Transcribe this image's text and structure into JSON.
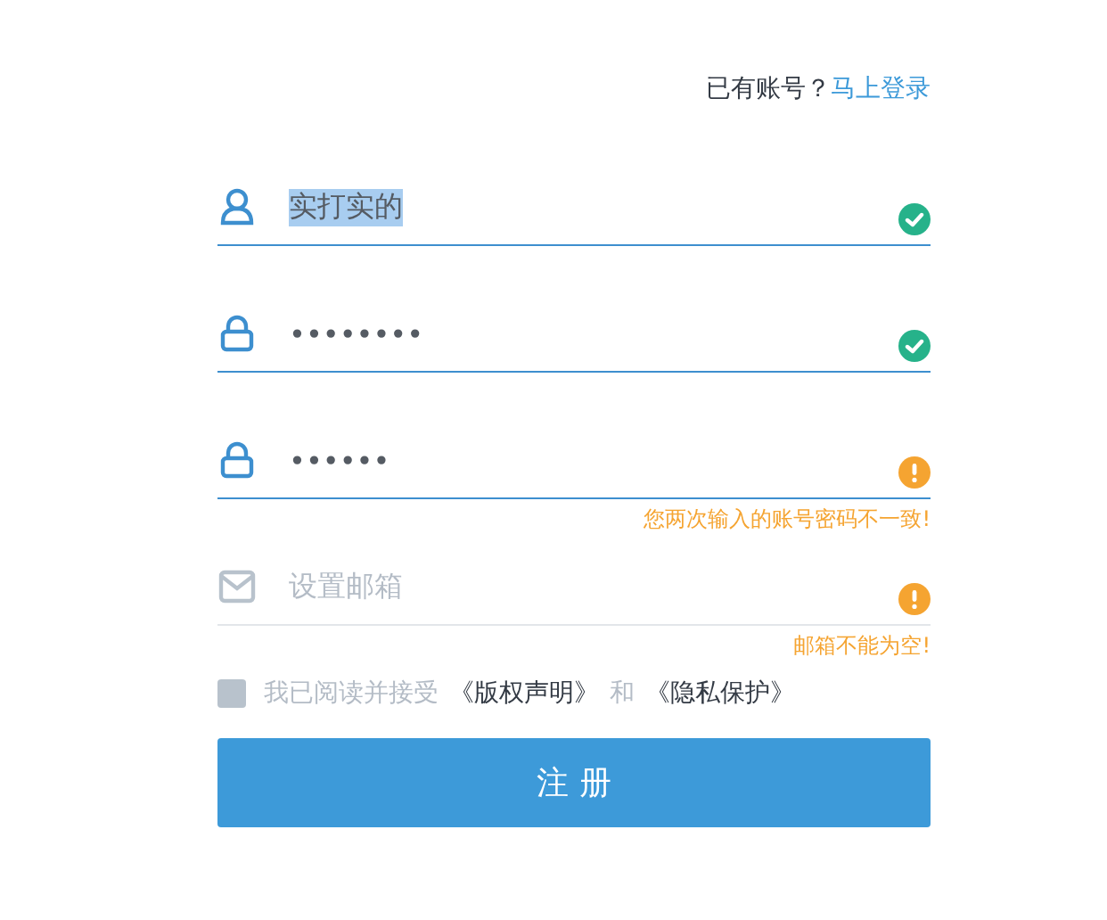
{
  "login_prompt": {
    "text": "已有账号？",
    "link": "马上登录"
  },
  "fields": [
    {
      "kind": "user",
      "value": "实打实的",
      "text_selected": true,
      "focused": true,
      "valid": true
    },
    {
      "kind": "lock",
      "value": "••••••••",
      "focused": true,
      "valid": true
    },
    {
      "kind": "lock",
      "value": "••••••",
      "focused": true,
      "valid": false,
      "error": "您两次输入的账号密码不一致!"
    },
    {
      "kind": "mail",
      "placeholder": "设置邮箱",
      "focused": false,
      "valid": false,
      "error": "邮箱不能为空!"
    }
  ],
  "agreement": {
    "checked": false,
    "text": "我已阅读并接受",
    "link_1": "《版权声明》",
    "joiner": "和",
    "link_2": "《隐私保护》"
  },
  "submit": "注 册"
}
